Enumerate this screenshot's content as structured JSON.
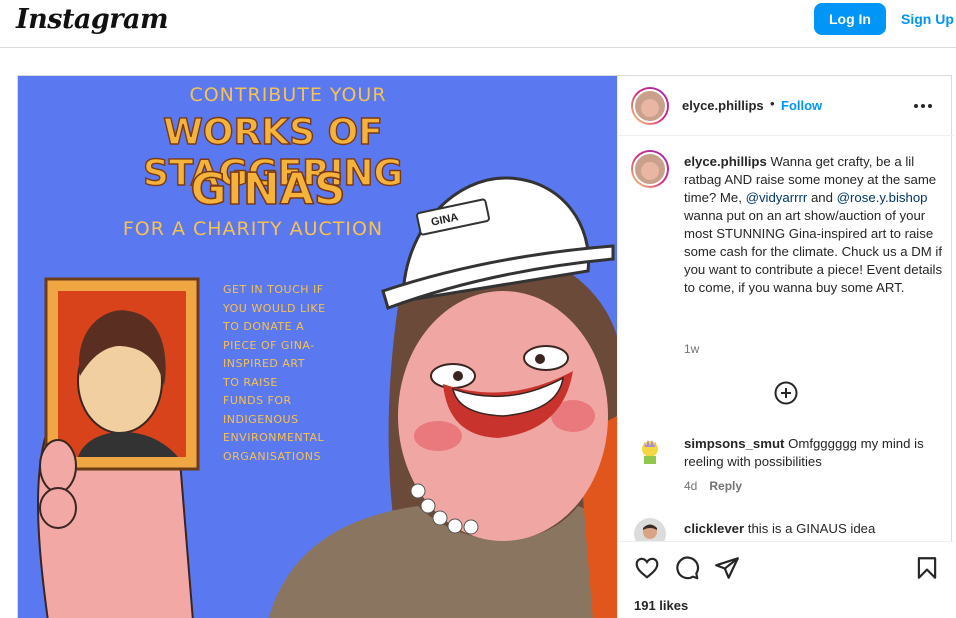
{
  "header": {
    "logo": "Instagram",
    "login_label": "Log In",
    "signup_label": "Sign Up"
  },
  "artwork": {
    "line1": "CONTRIBUTE YOUR",
    "line2": "WORKS OF STAGGERING",
    "line3": "GINAS",
    "line4": "FOR A CHARITY AUCTION",
    "hat_label": "GINA",
    "side_lines": [
      "GET IN TOUCH IF",
      "YOU WOULD LIKE",
      "TO DONATE A",
      "PIECE OF GINA-",
      "INSPIRED ART",
      "TO RAISE",
      "FUNDS FOR",
      "INDIGENOUS",
      "ENVIRONMENTAL",
      "ORGANISATIONS"
    ],
    "colors": {
      "background": "#5a78f0",
      "title": "#f6b33b"
    }
  },
  "post": {
    "username": "elyce.phillips",
    "separator": "•",
    "follow_label": "Follow",
    "caption_user": "elyce.phillips",
    "caption_text_1": " Wanna get crafty, be a lil ratbag AND raise some money at the same time? Me, ",
    "mention_1": "@vidyarrrr",
    "caption_text_2": " and ",
    "mention_2": "@rose.y.bishop",
    "caption_text_3": " wanna put on an art show/auction of your most STUNNING Gina-inspired art to raise some cash for the climate. Chuck us a DM if you want to contribute a piece! Event details to come, if you wanna buy some ART.",
    "caption_time": "1w",
    "likes": "191 likes"
  },
  "comments": [
    {
      "user": "simpsons_smut",
      "text": " Omfgggggg my mind is reeling with possibilities",
      "time": "4d",
      "reply": "Reply"
    },
    {
      "user": "clicklever",
      "text": " this is a GINAUS idea"
    }
  ],
  "icons": [
    "more-icon",
    "load-more-icon",
    "heart-icon",
    "comment-icon",
    "share-icon",
    "bookmark-icon"
  ],
  "colors": {
    "accent": "#0095f6",
    "mention": "#00376b"
  }
}
